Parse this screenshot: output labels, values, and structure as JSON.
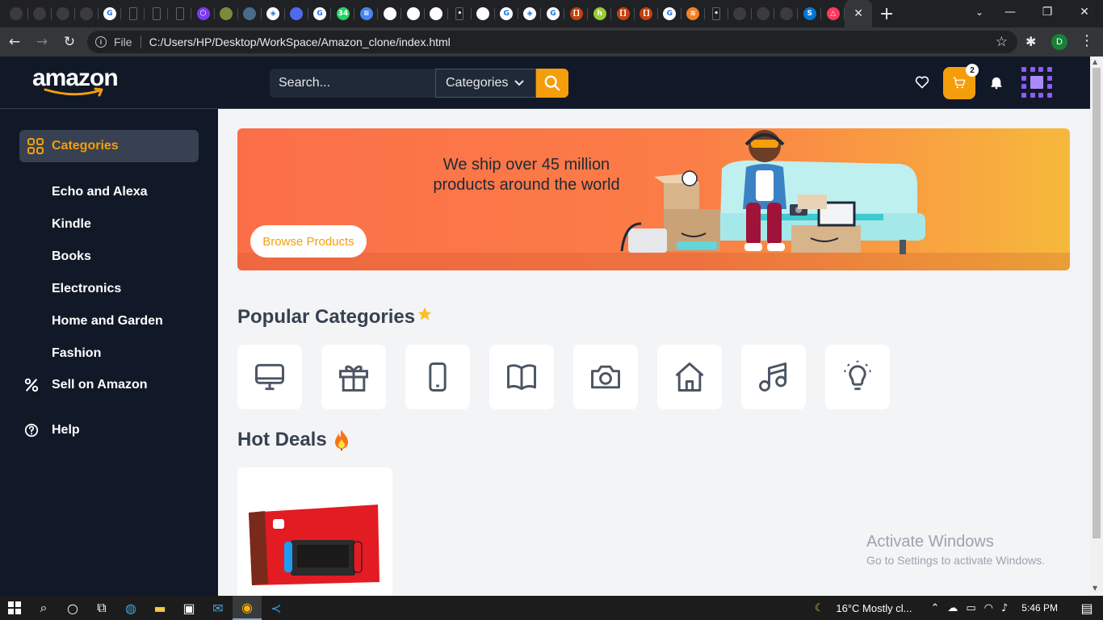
{
  "browser": {
    "tab_favicons": [
      {
        "icon": "github-icon",
        "color": "#3c3c3c",
        "glyph": ""
      },
      {
        "icon": "github-icon",
        "color": "#3c3c3c",
        "glyph": ""
      },
      {
        "icon": "github-icon",
        "color": "#3c3c3c",
        "glyph": ""
      },
      {
        "icon": "github-icon",
        "color": "#3c3c3c",
        "glyph": ""
      },
      {
        "icon": "google-icon",
        "color": "#ffffff",
        "glyph": "G"
      },
      {
        "icon": "blank-page-icon",
        "color": "#202124",
        "glyph": ""
      },
      {
        "icon": "blank-page-icon",
        "color": "#202124",
        "glyph": ""
      },
      {
        "icon": "blank-page-icon",
        "color": "#202124",
        "glyph": ""
      },
      {
        "icon": "hexagon-icon",
        "color": "#7c3aed",
        "glyph": "⬡"
      },
      {
        "icon": "app-icon",
        "color": "#7a8a3a",
        "glyph": ""
      },
      {
        "icon": "docs-icon",
        "color": "#4a6a8a",
        "glyph": ""
      },
      {
        "icon": "codesandbox-icon",
        "color": "#ffffff",
        "glyph": "◈"
      },
      {
        "icon": "teams-icon",
        "color": "#4f6bed",
        "glyph": ""
      },
      {
        "icon": "google-icon",
        "color": "#ffffff",
        "glyph": "G"
      },
      {
        "icon": "whatsapp-icon",
        "color": "#25d366",
        "glyph": "34"
      },
      {
        "icon": "google-docs-icon",
        "color": "#4285f4",
        "glyph": "≡"
      },
      {
        "icon": "compass-icon",
        "color": "#ffffff",
        "glyph": ""
      },
      {
        "icon": "compass-icon",
        "color": "#ffffff",
        "glyph": ""
      },
      {
        "icon": "compass-icon",
        "color": "#ffffff",
        "glyph": ""
      },
      {
        "icon": "dot-icon",
        "color": "#202124",
        "glyph": "•"
      },
      {
        "icon": "compass-icon",
        "color": "#ffffff",
        "glyph": ""
      },
      {
        "icon": "google-icon",
        "color": "#ffffff",
        "glyph": "G"
      },
      {
        "icon": "codesandbox-icon",
        "color": "#ffffff",
        "glyph": "◈"
      },
      {
        "icon": "google-icon",
        "color": "#ffffff",
        "glyph": "G"
      },
      {
        "icon": "bracket-icon",
        "color": "#c2410c",
        "glyph": "[]"
      },
      {
        "icon": "hackerrank-icon",
        "color": "#9acd32",
        "glyph": "h"
      },
      {
        "icon": "bracket-icon",
        "color": "#c2410c",
        "glyph": "[]"
      },
      {
        "icon": "bracket-icon",
        "color": "#c2410c",
        "glyph": "[]"
      },
      {
        "icon": "google-icon",
        "color": "#ffffff",
        "glyph": "G"
      },
      {
        "icon": "stackoverflow-icon",
        "color": "#f48024",
        "glyph": "≋"
      },
      {
        "icon": "dot-icon",
        "color": "#202124",
        "glyph": "•"
      },
      {
        "icon": "github-icon",
        "color": "#3c3c3c",
        "glyph": ""
      },
      {
        "icon": "github-icon",
        "color": "#3c3c3c",
        "glyph": ""
      },
      {
        "icon": "github-icon",
        "color": "#3c3c3c",
        "glyph": ""
      },
      {
        "icon": "skype-icon",
        "color": "#0078d4",
        "glyph": "S"
      },
      {
        "icon": "airbnb-icon",
        "color": "#ff385c",
        "glyph": "△"
      }
    ],
    "file_label": "File",
    "url": "C:/Users/HP/Desktop/WorkSpace/Amazon_clone/index.html",
    "profile_initial": "D"
  },
  "header": {
    "logo": "amazon",
    "search_placeholder": "Search...",
    "categories_label": "Categories",
    "cart_count": "2",
    "accent": "#f59e0b"
  },
  "sidebar": {
    "active_label": "Categories",
    "sub_items": [
      "Echo and Alexa",
      "Kindle",
      "Books",
      "Electronics",
      "Home and Garden",
      "Fashion"
    ],
    "sell_label": "Sell on Amazon",
    "help_label": "Help"
  },
  "banner": {
    "line1": "We ship over 45 million",
    "line2": "products around the world",
    "button": "Browse Products"
  },
  "popular": {
    "title": "Popular Categories",
    "icons": [
      "monitor-icon",
      "gift-icon",
      "phone-icon",
      "book-icon",
      "camera-icon",
      "home-icon",
      "music-icon",
      "lightbulb-icon"
    ]
  },
  "hot_deals": {
    "title": "Hot Deals"
  },
  "watermark": {
    "title": "Activate Windows",
    "subtitle": "Go to Settings to activate Windows."
  },
  "taskbar": {
    "temperature": "16°C",
    "weather": "Mostly cl...",
    "time": "5:46 PM"
  }
}
